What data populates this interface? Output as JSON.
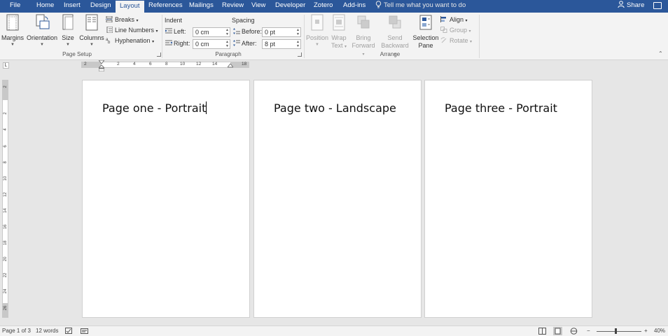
{
  "tabs": [
    "File",
    "Home",
    "Insert",
    "Design",
    "Layout",
    "References",
    "Mailings",
    "Review",
    "View",
    "Developer",
    "Zotero",
    "Add-ins"
  ],
  "active_tab": "Layout",
  "tell_me": "Tell me what you want to do",
  "share": "Share",
  "page_setup": {
    "margins": "Margins",
    "orientation": "Orientation",
    "size": "Size",
    "columns": "Columns",
    "breaks": "Breaks",
    "line_numbers": "Line Numbers",
    "hyphenation": "Hyphenation",
    "label": "Page Setup"
  },
  "paragraph": {
    "indent_label": "Indent",
    "left_label": "Left:",
    "left_value": "0 cm",
    "right_label": "Right:",
    "right_value": "0 cm",
    "spacing_label": "Spacing",
    "before_label": "Before:",
    "before_value": "0 pt",
    "after_label": "After:",
    "after_value": "8 pt",
    "label": "Paragraph"
  },
  "arrange": {
    "position": "Position",
    "wrap_text_1": "Wrap",
    "wrap_text_2": "Text",
    "bring_forward_1": "Bring",
    "bring_forward_2": "Forward",
    "send_backward_1": "Send",
    "send_backward_2": "Backward",
    "selection_pane_1": "Selection",
    "selection_pane_2": "Pane",
    "align": "Align",
    "group": "Group",
    "rotate": "Rotate",
    "label": "Arrange"
  },
  "ruler": {
    "h_ticks": [
      "2",
      "2",
      "4",
      "6",
      "8",
      "10",
      "12",
      "14",
      "18"
    ],
    "v_ticks": [
      "2",
      "2",
      "4",
      "6",
      "8",
      "10",
      "12",
      "14",
      "16",
      "18",
      "20",
      "22",
      "24",
      "26"
    ]
  },
  "pages": [
    {
      "text": "Page one - Portrait"
    },
    {
      "text": "Page two - Landscape"
    },
    {
      "text": "Page three - Portrait"
    }
  ],
  "status": {
    "page": "Page 1 of 3",
    "words": "12 words",
    "zoom": "40%"
  },
  "colors": {
    "accent": "#2b579a",
    "ribbon": "#f3f3f3",
    "canvas": "#e6e6e6"
  }
}
